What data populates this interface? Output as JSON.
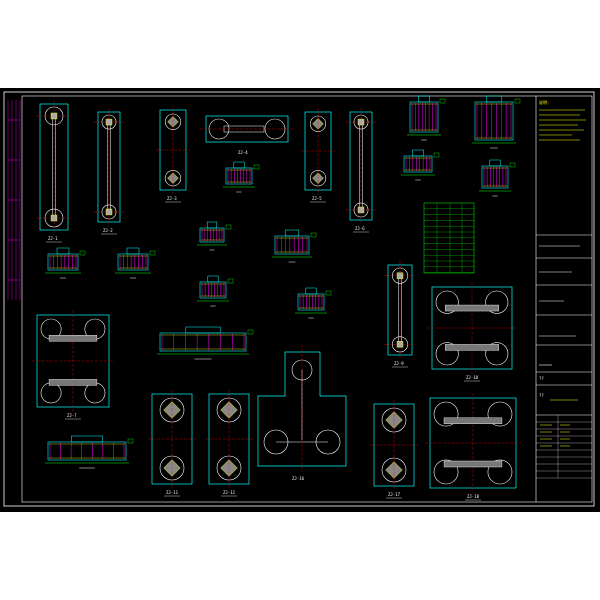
{
  "colors": {
    "background": "#000000",
    "frame": "#ffffff",
    "outline": "#00ffff",
    "centerline": "#ff0000",
    "rebar": "#ff00ff",
    "annotation": "#00ff00",
    "dimension": "#ffff00"
  },
  "notes": {
    "title": "说明："
  },
  "title_block": {
    "stamp": "??",
    "sheet_no": "??"
  },
  "detail_labels": {
    "zj1": "ZJ-1",
    "zj2": "ZJ-2",
    "zj3": "ZJ-3",
    "zj4": "ZJ-4",
    "zj5": "ZJ-5",
    "zj6": "ZJ-6",
    "zj7": "ZJ-7",
    "zj8": "ZJ-8",
    "zj9": "ZJ-9",
    "zj10": "ZJ-10",
    "zj11": "ZJ-11",
    "zj12": "ZJ-12",
    "zj13": "ZJ-13",
    "zj14": "ZJ-14",
    "zj15": "ZJ-15",
    "zj16": "ZJ-16",
    "zj17": "ZJ-17",
    "zj18": "ZJ-18"
  }
}
